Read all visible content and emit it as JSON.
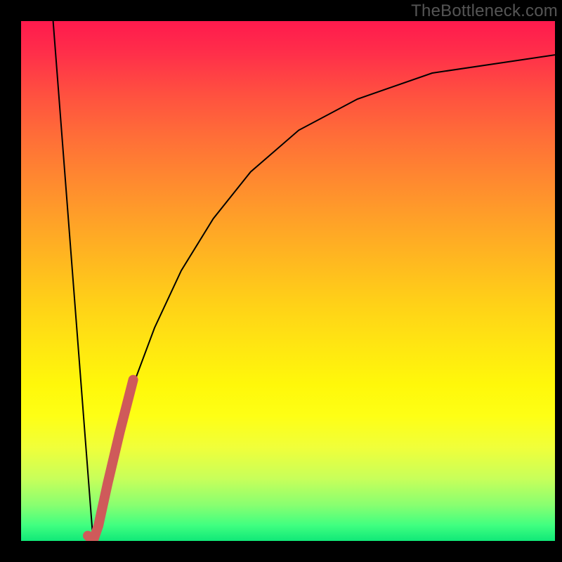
{
  "watermark": "TheBottleneck.com",
  "chart_data": {
    "type": "line",
    "title": "",
    "xlabel": "",
    "ylabel": "",
    "xlim": [
      0,
      100
    ],
    "ylim": [
      0,
      100
    ],
    "grid": false,
    "legend": false,
    "series": [
      {
        "name": "left-descend",
        "color": "#000000",
        "stroke_width": 2,
        "x": [
          6,
          13.5
        ],
        "values": [
          100,
          0
        ]
      },
      {
        "name": "right-asymptote",
        "color": "#000000",
        "stroke_width": 2,
        "x": [
          13.5,
          16,
          18,
          21,
          25,
          30,
          36,
          43,
          52,
          63,
          77,
          100
        ],
        "values": [
          0,
          11,
          20,
          30,
          41,
          52,
          62,
          71,
          79,
          85,
          90,
          93.5
        ]
      },
      {
        "name": "highlight-hook",
        "color": "#cf5a5a",
        "stroke_width": 14,
        "linecap": "round",
        "x": [
          12.5,
          13.5,
          14.5,
          16.2,
          18.5,
          21
        ],
        "values": [
          1,
          0,
          3,
          11,
          21,
          31
        ]
      }
    ],
    "background_gradient": {
      "direction": "vertical",
      "stops": [
        {
          "pos": 0,
          "color": "#ff1a4d"
        },
        {
          "pos": 50,
          "color": "#ffb020"
        },
        {
          "pos": 75,
          "color": "#fff80a"
        },
        {
          "pos": 100,
          "color": "#10e878"
        }
      ]
    }
  }
}
